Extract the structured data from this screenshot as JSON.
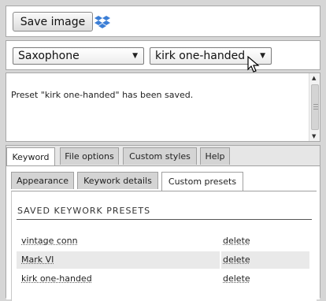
{
  "toolbar": {
    "save_label": "Save image"
  },
  "selects": {
    "instrument": "Saxophone",
    "preset": "kirk one-handed"
  },
  "message": {
    "text": "Preset \"kirk one-handed\" has been saved."
  },
  "tabs": [
    {
      "label": "Keyword",
      "active": true
    },
    {
      "label": "File options",
      "active": false
    },
    {
      "label": "Custom styles",
      "active": false
    },
    {
      "label": "Help",
      "active": false
    }
  ],
  "subtabs": [
    {
      "label": "Appearance",
      "active": false
    },
    {
      "label": "Keywork details",
      "active": false
    },
    {
      "label": "Custom presets",
      "active": true
    }
  ],
  "presets_section": {
    "title": "SAVED KEYWORK PRESETS",
    "delete_label": "delete",
    "items": [
      "vintage conn",
      "Mark VI",
      "kirk one-handed"
    ]
  },
  "colors": {
    "panel_border": "#a8a8a8",
    "background": "#d6d6d6",
    "alt_row": "#e9e9e9",
    "dropbox_blue": "#3b7ed6"
  },
  "icons": [
    "dropbox-icon",
    "chevron-down-icon",
    "mouse-cursor-icon",
    "scroll-up-icon",
    "scroll-down-icon"
  ]
}
